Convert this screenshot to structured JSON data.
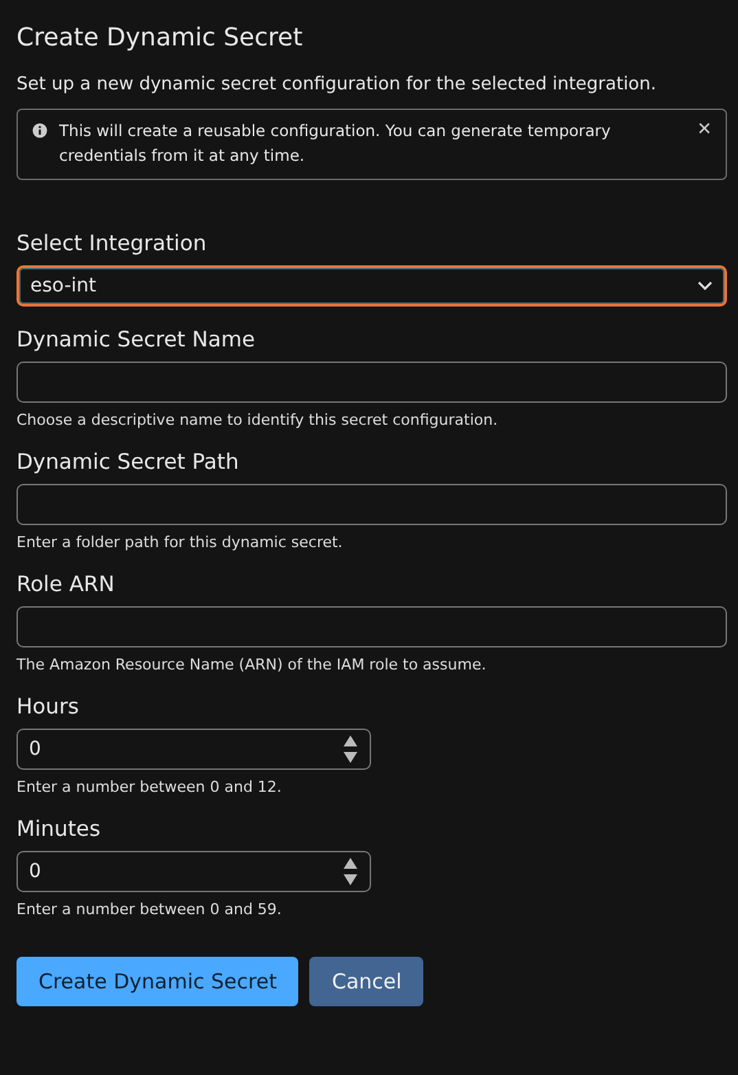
{
  "title": "Create Dynamic Secret",
  "description": "Set up a new dynamic secret configuration for the selected integration.",
  "alert": {
    "text": "This will create a reusable configuration. You can generate temporary credentials from it at any time.",
    "close": "✕"
  },
  "fields": [
    {
      "kind": "select",
      "label": "Select Integration",
      "value": "eso-int",
      "focused": true
    },
    {
      "kind": "text",
      "label": "Dynamic Secret Name",
      "help": "Choose a descriptive name to identify this secret configuration.",
      "focused": false
    },
    {
      "kind": "text",
      "label": "Dynamic Secret Path",
      "help": "Enter a folder path for this dynamic secret.",
      "focused": false
    },
    {
      "kind": "text",
      "label": "Role ARN",
      "help": "The Amazon Resource Name (ARN) of the IAM role to assume.",
      "focused": false
    },
    {
      "kind": "number",
      "label": "Hours",
      "value": "0",
      "help": "Enter a number between 0 and 12.",
      "focused": false
    },
    {
      "kind": "number",
      "label": "Minutes",
      "value": "0",
      "help": "Enter a number between 0 and 59.",
      "focused": false
    }
  ],
  "buttons": [
    {
      "label": "Create Dynamic Secret",
      "kind": "primary"
    },
    {
      "label": "Cancel",
      "kind": "secondary"
    }
  ]
}
